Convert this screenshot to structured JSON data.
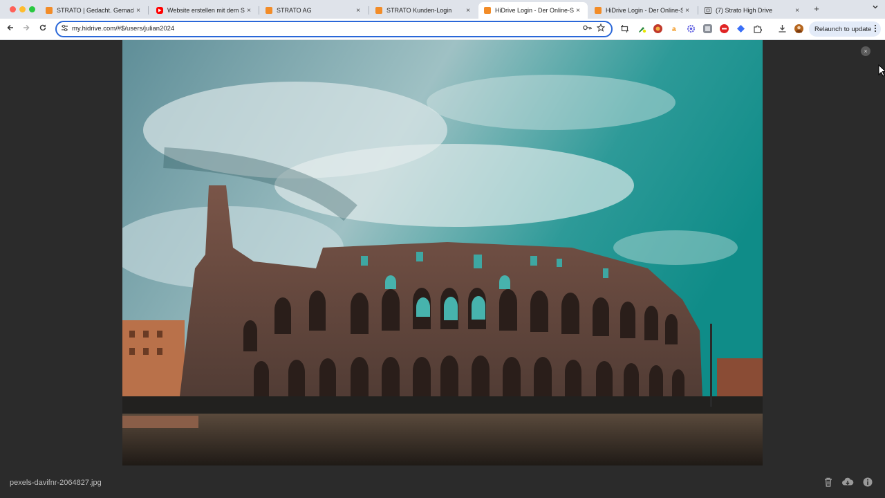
{
  "browser": {
    "tabs": [
      {
        "title": "STRATO | Gedacht. Gemacht.",
        "icon": "strato-icon",
        "active": false
      },
      {
        "title": "Website erstellen mit dem ST",
        "icon": "youtube-icon",
        "active": false
      },
      {
        "title": "STRATO AG",
        "icon": "strato-icon",
        "active": false
      },
      {
        "title": "STRATO Kunden-Login",
        "icon": "strato-icon",
        "active": false
      },
      {
        "title": "HiDrive Login - Der Online-Sp",
        "icon": "strato-icon",
        "active": true
      },
      {
        "title": "HiDrive Login - Der Online-Sp",
        "icon": "strato-icon",
        "active": false
      },
      {
        "title": "(7) Strato High Drive",
        "icon": "generic-page-icon",
        "active": false
      }
    ],
    "tab_close_glyph": "×",
    "new_tab_glyph": "+",
    "url": "my.hidrive.com/#$/users/julian2024",
    "relaunch_label": "Relaunch to update"
  },
  "viewer": {
    "filename": "pexels-davifnr-2064827.jpg",
    "close_glyph": "×"
  },
  "colors": {
    "strato_orange": "#f28c28",
    "youtube_red": "#ff0000",
    "omnibox_focus": "#2a67d8",
    "viewer_bg": "#2b2b2b"
  }
}
